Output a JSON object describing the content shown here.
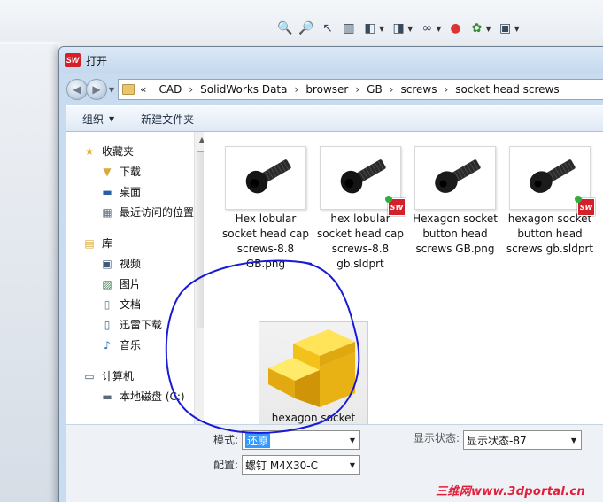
{
  "heads_up_toolbar": {
    "icons": [
      "zoom-to-fit-icon",
      "zoom-area-icon",
      "previous-view-icon",
      "section-view-icon",
      "view-orientation-icon",
      "display-style-icon",
      "hide-show-icon",
      "edit-appearance-icon",
      "apply-scene-icon",
      "view-settings-icon"
    ]
  },
  "dialog": {
    "title": "打开",
    "breadcrumb": [
      "CAD",
      "SolidWorks Data",
      "browser",
      "GB",
      "screws",
      "socket head screws"
    ],
    "breadcrumb_prefix": "«",
    "toolbar": {
      "organize": "组织",
      "new_folder": "新建文件夹"
    },
    "nav": {
      "favorites": "收藏夹",
      "downloads": "下载",
      "desktop": "桌面",
      "recent": "最近访问的位置",
      "libraries": "库",
      "videos": "视频",
      "pictures": "图片",
      "documents": "文档",
      "thunder": "迅雷下载",
      "music": "音乐",
      "computer": "计算机",
      "local_disk": "本地磁盘 (C:)"
    },
    "files": [
      {
        "name": "Hex lobular socket head cap screws-8.8 GB.png",
        "type": "png"
      },
      {
        "name": "hex lobular socket head cap screws-8.8 gb.sldprt",
        "type": "sldprt"
      },
      {
        "name": "Hexagon socket button head screws GB.png",
        "type": "png"
      },
      {
        "name": "hexagon socket button head screws gb.sldprt",
        "type": "sldprt"
      },
      {
        "name": "hexagon socket head cap screws gb.sldprt",
        "type": "sldprt-generic"
      }
    ],
    "options": {
      "mode_label": "模式:",
      "mode_value": "还原",
      "display_state_label": "显示状态:",
      "display_state_value": "显示状态-87",
      "config_label": "配置:",
      "config_value": "螺钉 M4X30-C"
    }
  },
  "watermark": "三维网www.3dportal.cn",
  "colors": {
    "annotation_circle": "#1a1ad6",
    "solidworks_red": "#d3202a",
    "selection_blue": "#3399ff"
  }
}
